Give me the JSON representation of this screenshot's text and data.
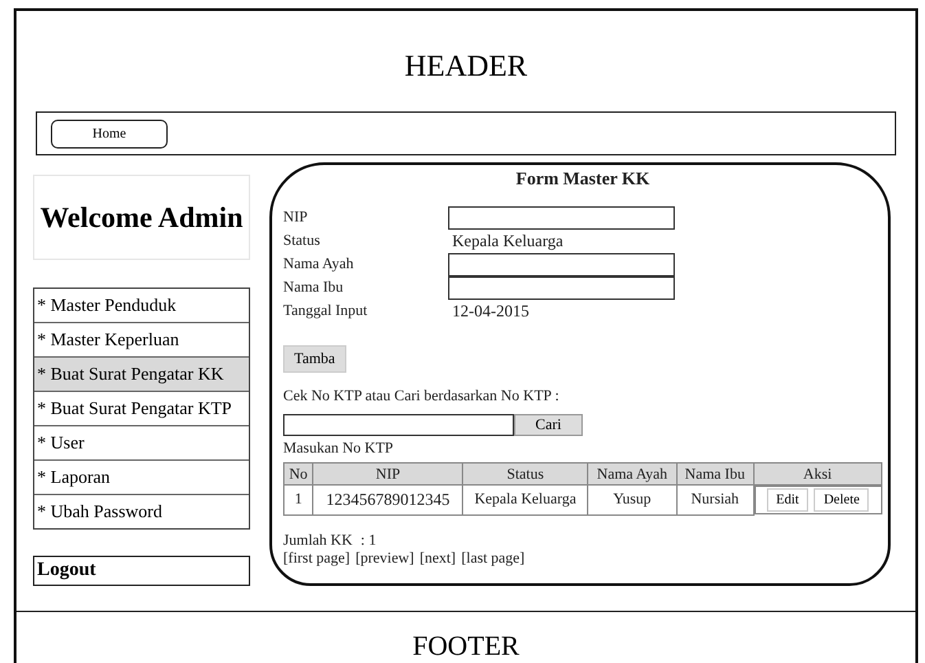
{
  "header": {
    "title": "HEADER"
  },
  "nav": {
    "home_button": "Home"
  },
  "sidebar": {
    "welcome": "Welcome Admin",
    "items": [
      {
        "label": "* Master Penduduk",
        "selected": false
      },
      {
        "label": "* Master Keperluan",
        "selected": false
      },
      {
        "label": "* Buat Surat Pengatar KK",
        "selected": true
      },
      {
        "label": "* Buat Surat Pengatar KTP",
        "selected": false
      },
      {
        "label": "* User",
        "selected": false
      },
      {
        "label": "* Laporan",
        "selected": false
      },
      {
        "label": "* Ubah Password",
        "selected": false
      }
    ],
    "logout": "Logout"
  },
  "form": {
    "title": "Form Master KK",
    "fields": [
      {
        "label": "NIP",
        "kind": "input"
      },
      {
        "label": "Status",
        "kind": "text",
        "value": "Kepala Keluarga"
      },
      {
        "label": "Nama Ayah",
        "kind": "input"
      },
      {
        "label": "Nama Ibu",
        "kind": "input"
      },
      {
        "label": "Tanggal Input",
        "kind": "text",
        "value": "12-04-2015"
      }
    ],
    "add_button": "Tamba",
    "search_label": "Cek No KTP atau Cari berdasarkan No KTP :",
    "search_button": "Cari",
    "search_hint": "Masukan No KTP",
    "table": {
      "columns": [
        "No",
        "NIP",
        "Status",
        "Nama Ayah",
        "Nama Ibu",
        "Aksi"
      ],
      "rows": [
        {
          "no": "1",
          "nip": "123456789012345",
          "status": "Kepala Keluarga",
          "nama_ayah": "Yusup",
          "nama_ibu": "Nursiah",
          "actions": [
            "Edit",
            "Delete"
          ]
        }
      ]
    },
    "total_label": "Jumlah KK",
    "total_value": ": 1",
    "pagination": [
      "[first page]",
      "[preview]",
      "[next]",
      "[last page]"
    ]
  },
  "footer": {
    "title": "FOOTER"
  }
}
